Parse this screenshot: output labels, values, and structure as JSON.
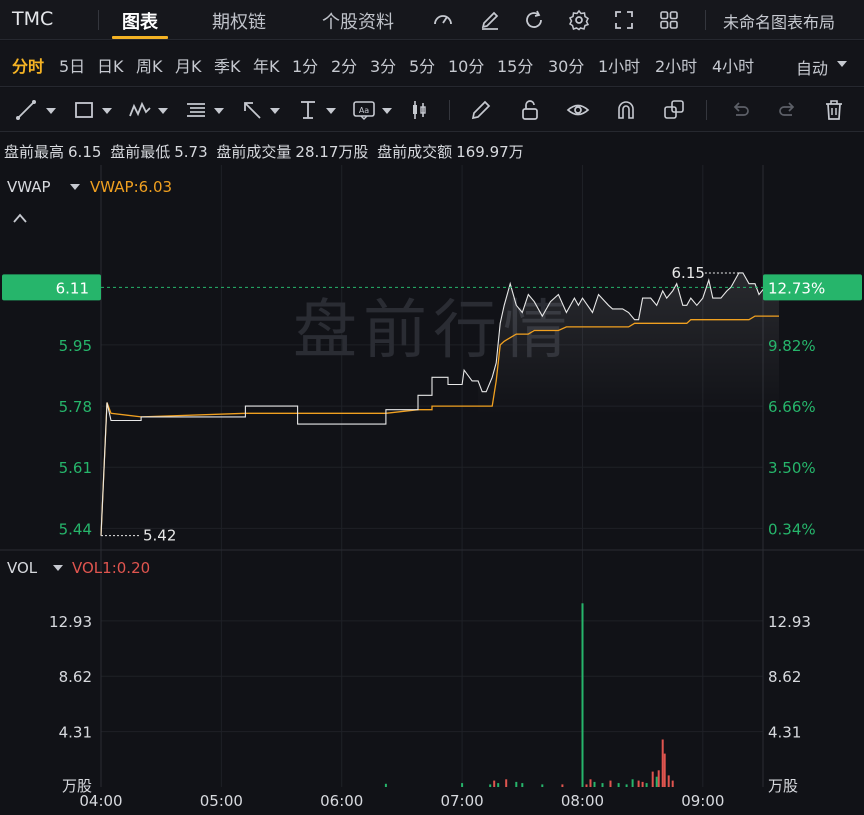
{
  "header": {
    "ticker": "TMC",
    "tabs": [
      {
        "label": "图表",
        "active": true
      },
      {
        "label": "期权链",
        "active": false
      },
      {
        "label": "个股资料",
        "active": false
      }
    ],
    "icons": [
      "gauge-icon",
      "edit-icon",
      "refresh-icon",
      "settings-icon",
      "fullscreen-icon",
      "grid-icon"
    ],
    "layout_label": "未命名图表布局"
  },
  "periods": {
    "items": [
      "分时",
      "5日",
      "日K",
      "周K",
      "月K",
      "季K",
      "年K",
      "1分",
      "2分",
      "3分",
      "5分",
      "10分",
      "15分",
      "30分",
      "1小时",
      "2小时",
      "4小时"
    ],
    "active": "分时",
    "mode": "自动"
  },
  "drawing_tools": [
    "trendline-tool-icon",
    "rectangle-tool-icon",
    "pattern-tool-icon",
    "fib-tool-icon",
    "arrow-tool-icon",
    "measure-tool-icon",
    "text-tool-icon",
    "candle-tool-icon",
    "pencil-icon",
    "unlock-icon",
    "eye-icon",
    "magnet-icon",
    "copy-icon",
    "undo-icon",
    "redo-icon",
    "trash-icon"
  ],
  "premarket": {
    "high_label": "盘前最高",
    "high": "6.15",
    "low_label": "盘前最低",
    "low": "5.73",
    "volume_label": "盘前成交量",
    "volume": "28.17万股",
    "amount_label": "盘前成交额",
    "amount": "169.97万"
  },
  "colors": {
    "up": "#26b56b",
    "down": "#e0554f",
    "vwap": "#f0a020",
    "price_line": "#e8e8e8",
    "accent": "#f5b324"
  },
  "watermark": "盘前行情",
  "main_pane": {
    "indicator": "VWAP",
    "indicator_value": "VWAP:6.03",
    "current_price": "6.11",
    "current_pct": "12.73%",
    "high_annotation": "6.15",
    "low_annotation": "5.42",
    "y_ticks_left": [
      "5.95",
      "5.78",
      "5.61",
      "5.44"
    ],
    "y_ticks_right": [
      "9.82%",
      "6.66%",
      "3.50%",
      "0.34%"
    ]
  },
  "volume_pane": {
    "indicator": "VOL",
    "indicator_value": "VOL1:0.20",
    "y_ticks": [
      "12.93",
      "8.62",
      "4.31"
    ],
    "unit": "万股"
  },
  "x_ticks": [
    "04:00",
    "05:00",
    "06:00",
    "07:00",
    "08:00",
    "09:00"
  ],
  "chart_data": [
    {
      "type": "line",
      "x": [
        "04:00",
        "04:03",
        "04:05",
        "04:20",
        "04:20",
        "05:12",
        "05:12",
        "05:38",
        "05:38",
        "06:22",
        "06:22",
        "06:38",
        "06:38",
        "06:45",
        "06:45",
        "06:53",
        "06:53",
        "07:00",
        "07:01",
        "07:05",
        "07:08",
        "07:10",
        "07:12",
        "07:15",
        "07:17",
        "07:19",
        "07:21",
        "07:24",
        "07:27",
        "07:30",
        "07:33",
        "07:36",
        "07:40",
        "07:44",
        "07:48",
        "07:52",
        "07:56",
        "07:58",
        "08:00",
        "08:05",
        "08:08",
        "08:13",
        "08:15",
        "08:18",
        "08:20",
        "08:23",
        "08:26",
        "08:28",
        "08:30",
        "08:34",
        "08:37",
        "08:40",
        "08:42",
        "08:45",
        "08:47",
        "08:50",
        "08:52",
        "08:54",
        "08:57",
        "09:00",
        "09:03",
        "09:05",
        "09:09",
        "09:12",
        "09:14",
        "09:18",
        "09:20",
        "09:23",
        "09:26",
        "09:28",
        "09:31",
        "09:33",
        "09:35",
        "09:38"
      ],
      "series": [
        {
          "name": "",
          "values": [
            5.42,
            5.79,
            5.74,
            5.74,
            5.75,
            5.75,
            5.78,
            5.78,
            5.73,
            5.73,
            5.77,
            5.77,
            5.81,
            5.81,
            5.86,
            5.86,
            5.84,
            5.84,
            5.88,
            5.85,
            5.85,
            5.82,
            5.82,
            5.86,
            5.9,
            6.01,
            6.06,
            6.12,
            6.06,
            6.04,
            6.09,
            6.07,
            6.03,
            6.07,
            6.09,
            6.04,
            6.08,
            6.06,
            6.08,
            6.04,
            6.09,
            6.06,
            6.05,
            6.05,
            6.05,
            6.04,
            6.02,
            6.02,
            6.08,
            6.08,
            6.06,
            6.1,
            6.08,
            6.1,
            6.12,
            6.06,
            6.06,
            6.08,
            6.06,
            6.08,
            6.13,
            6.08,
            6.08,
            6.1,
            6.11,
            6.15,
            6.15,
            6.12,
            6.12,
            6.09,
            6.11,
            6.08,
            6.09,
            6.11
          ]
        },
        {
          "name": "VWAP",
          "values": [
            5.42,
            5.79,
            5.76,
            5.75,
            5.75,
            5.76,
            5.76,
            5.76,
            5.76,
            5.76,
            5.76,
            5.77,
            5.77,
            5.77,
            5.78,
            5.78,
            5.78,
            5.78,
            5.78,
            5.78,
            5.78,
            5.78,
            5.78,
            5.78,
            5.85,
            5.95,
            5.96,
            5.97,
            5.98,
            5.98,
            5.98,
            5.99,
            5.99,
            5.99,
            5.99,
            6.0,
            6.0,
            6.0,
            6.0,
            6.0,
            6.0,
            6.0,
            6.0,
            6.0,
            6.0,
            6.0,
            6.01,
            6.01,
            6.01,
            6.01,
            6.01,
            6.01,
            6.01,
            6.01,
            6.01,
            6.01,
            6.01,
            6.02,
            6.02,
            6.02,
            6.02,
            6.02,
            6.02,
            6.02,
            6.02,
            6.02,
            6.02,
            6.02,
            6.03,
            6.03,
            6.03,
            6.03,
            6.03,
            6.03
          ]
        }
      ],
      "ylim": [
        5.38,
        6.45
      ]
    },
    {
      "type": "bar",
      "x": [
        "06:22",
        "07:00",
        "07:14",
        "07:16",
        "07:18",
        "07:22",
        "07:27",
        "07:30",
        "07:40",
        "07:50",
        "08:00",
        "08:02",
        "08:04",
        "08:06",
        "08:10",
        "08:14",
        "08:18",
        "08:22",
        "08:25",
        "08:28",
        "08:30",
        "08:32",
        "08:35",
        "08:37",
        "08:38",
        "08:40",
        "08:41",
        "08:43",
        "08:45"
      ],
      "values": [
        0.25,
        0.3,
        0.2,
        0.5,
        0.3,
        0.6,
        0.4,
        0.3,
        0.2,
        0.2,
        14.3,
        0.2,
        0.6,
        0.4,
        0.3,
        0.5,
        0.3,
        0.2,
        0.6,
        0.5,
        0.4,
        0.3,
        1.2,
        0.8,
        1.3,
        3.7,
        2.6,
        0.9,
        0.5
      ],
      "colors": [
        "up",
        "up",
        "up",
        "down",
        "up",
        "down",
        "up",
        "up",
        "up",
        "down",
        "up",
        "down",
        "down",
        "up",
        "up",
        "down",
        "up",
        "up",
        "up",
        "down",
        "down",
        "up",
        "down",
        "up",
        "down",
        "down",
        "down",
        "down",
        "down"
      ],
      "ylim": [
        0,
        16.5
      ]
    }
  ]
}
